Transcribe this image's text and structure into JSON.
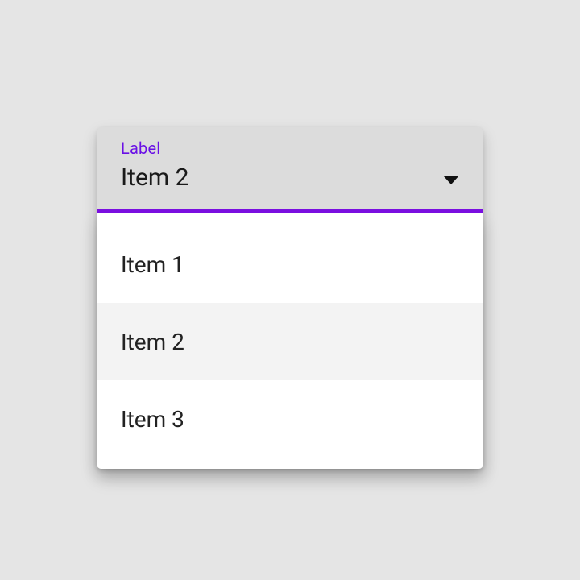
{
  "colors": {
    "accent": "#7a0fe0",
    "label": "#6a10e6",
    "fieldBg": "#dcdcdc",
    "pageBg": "#e5e5e5",
    "selectedBg": "#f3f3f3"
  },
  "select": {
    "label": "Label",
    "value": "Item 2",
    "options": [
      {
        "label": "Item 1",
        "selected": false
      },
      {
        "label": "Item 2",
        "selected": true
      },
      {
        "label": "Item 3",
        "selected": false
      }
    ]
  }
}
